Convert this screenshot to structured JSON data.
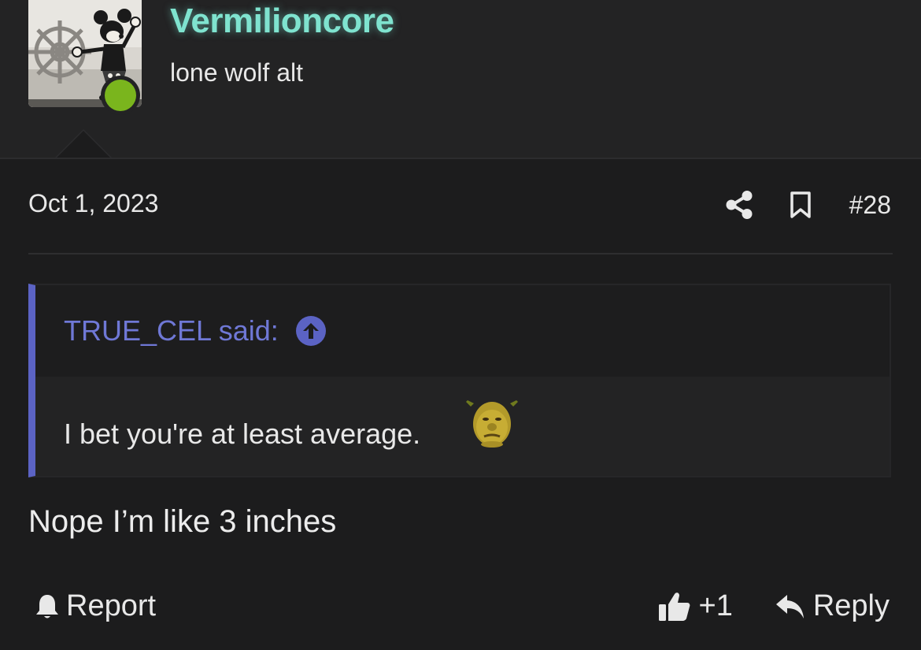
{
  "user": {
    "name": "Vermilioncore",
    "title": "lone wolf alt",
    "name_color": "#7fe3cf",
    "status_color": "#7ab51d",
    "avatar_icon": "steamboat-willie-avatar"
  },
  "post": {
    "date": "Oct 1, 2023",
    "number": "#28",
    "message": "Nope I’m like 3 inches"
  },
  "quote": {
    "author_line": "TRUE_CEL said:",
    "body": "I bet you're at least average.",
    "accent_color": "#5b63c4",
    "emoji_icon": "shrek-face-emoji"
  },
  "footer": {
    "report_label": "Report",
    "like_count": "+1",
    "reply_label": "Reply"
  }
}
